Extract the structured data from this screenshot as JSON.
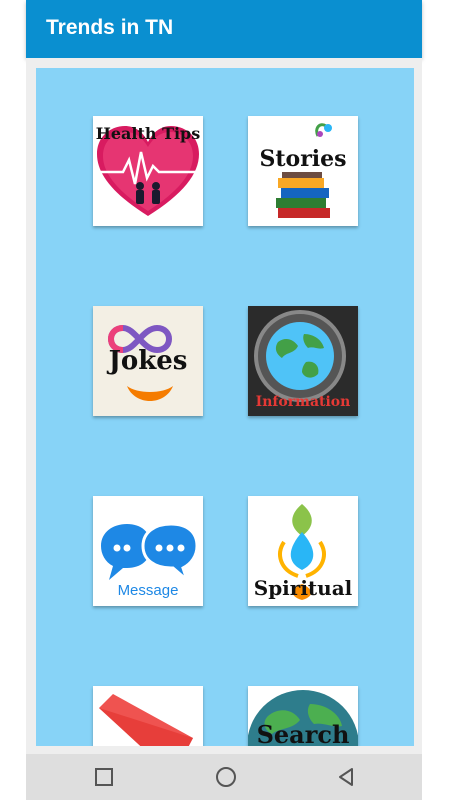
{
  "appbar": {
    "title": "Trends in TN"
  },
  "tiles": [
    {
      "label": "Health Tips"
    },
    {
      "label": "Stories"
    },
    {
      "label": "Jokes"
    },
    {
      "label": "Information"
    },
    {
      "label": "Message"
    },
    {
      "label": "Spiritual"
    },
    {
      "label": ""
    },
    {
      "label": "Search"
    }
  ],
  "colors": {
    "appbar": "#0a8fd0",
    "grid_background": "#87d3f7",
    "navbar": "#dedede"
  },
  "navbar": {
    "icons": [
      "recents-square-icon",
      "home-circle-icon",
      "back-triangle-icon"
    ]
  }
}
